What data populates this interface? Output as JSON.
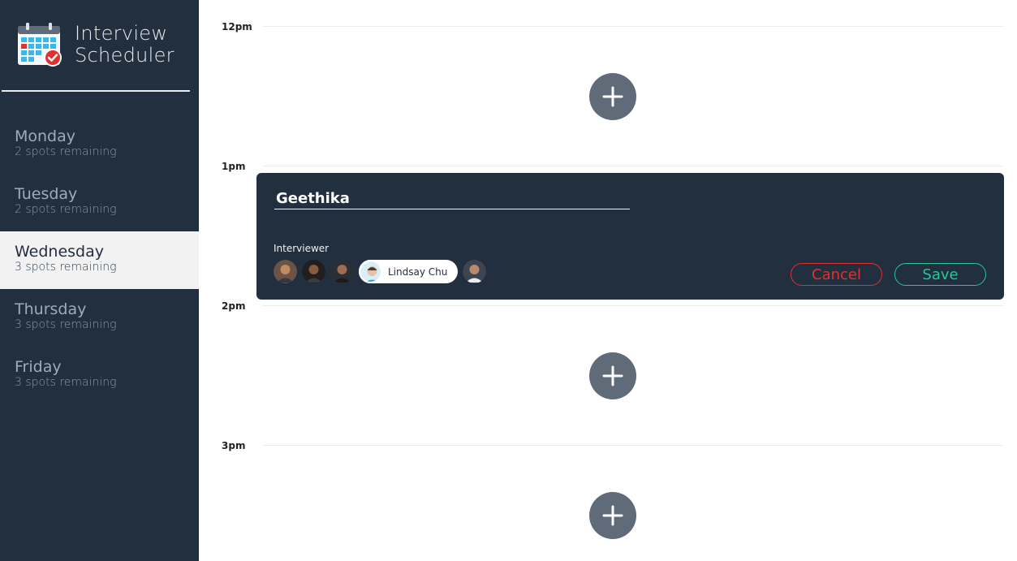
{
  "app": {
    "title_line1": "Interview",
    "title_line2": "Scheduler"
  },
  "days": [
    {
      "name": "Monday",
      "spots": "2 spots remaining",
      "selected": false
    },
    {
      "name": "Tuesday",
      "spots": "2 spots remaining",
      "selected": false
    },
    {
      "name": "Wednesday",
      "spots": "3 spots remaining",
      "selected": true
    },
    {
      "name": "Thursday",
      "spots": "3 spots remaining",
      "selected": false
    },
    {
      "name": "Friday",
      "spots": "3 spots remaining",
      "selected": false
    }
  ],
  "schedule": {
    "times": [
      "12pm",
      "1pm",
      "2pm",
      "3pm"
    ]
  },
  "form": {
    "student_name": "Geethika",
    "interviewer_label": "Interviewer",
    "selected_interviewer": "Lindsay Chu",
    "cancel_label": "Cancel",
    "save_label": "Save"
  },
  "colors": {
    "sidebar": "#222f3e",
    "accent_cancel": "#e03131",
    "accent_save": "#20c997",
    "add_button": "#5f6b78"
  },
  "icons": {
    "logo": "calendar-check-icon",
    "add": "plus-icon"
  }
}
